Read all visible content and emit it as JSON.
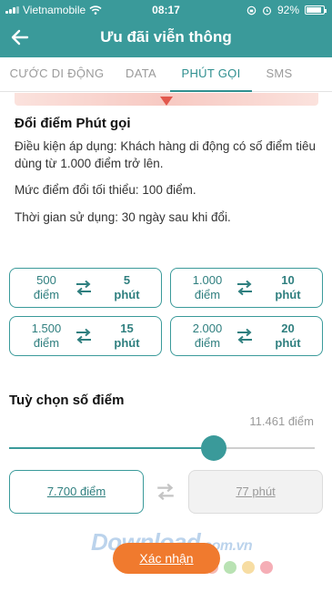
{
  "status_bar": {
    "carrier": "Vietnamobile",
    "time": "08:17",
    "battery": "92%",
    "battery_level": 0.92
  },
  "header": {
    "title": "Ưu đãi viễn thông"
  },
  "tabs": [
    {
      "label": "CƯỚC DI ĐỘNG",
      "active": false
    },
    {
      "label": "DATA",
      "active": false
    },
    {
      "label": "PHÚT GỌI",
      "active": true
    },
    {
      "label": "SMS",
      "active": false
    }
  ],
  "section": {
    "title": "Đổi điểm Phút gọi",
    "condition": "Điều kiện áp dụng: Khách hàng di động có số điểm tiêu dùng từ 1.000 điểm trở lên.",
    "min_points": "Mức điểm đổi tối thiểu: 100 điểm.",
    "usage_time": "Thời gian sử dụng: 30 ngày sau khi đổi."
  },
  "options": [
    {
      "points": "500",
      "points_unit": "điểm",
      "minutes": "5",
      "minutes_unit": "phút"
    },
    {
      "points": "1.000",
      "points_unit": "điểm",
      "minutes": "10",
      "minutes_unit": "phút"
    },
    {
      "points": "1.500",
      "points_unit": "điểm",
      "minutes": "15",
      "minutes_unit": "phút"
    },
    {
      "points": "2.000",
      "points_unit": "điểm",
      "minutes": "20",
      "minutes_unit": "phút"
    }
  ],
  "custom": {
    "title": "Tuỳ chọn số điểm",
    "max_points": "11.461 điểm",
    "slider_fraction": 0.67,
    "points_value": "7.700 điểm",
    "minutes_value": "77 phút"
  },
  "confirm_label": "Xác nhận",
  "watermark": {
    "brand": "Download",
    "suffix": ".com.vn"
  },
  "colors": {
    "primary": "#3a9a9a",
    "accent": "#f07a2e",
    "dots": [
      "#5b8fd6",
      "#f3a9a0",
      "#a8dba0",
      "#f5d48c",
      "#f39aa4"
    ]
  }
}
